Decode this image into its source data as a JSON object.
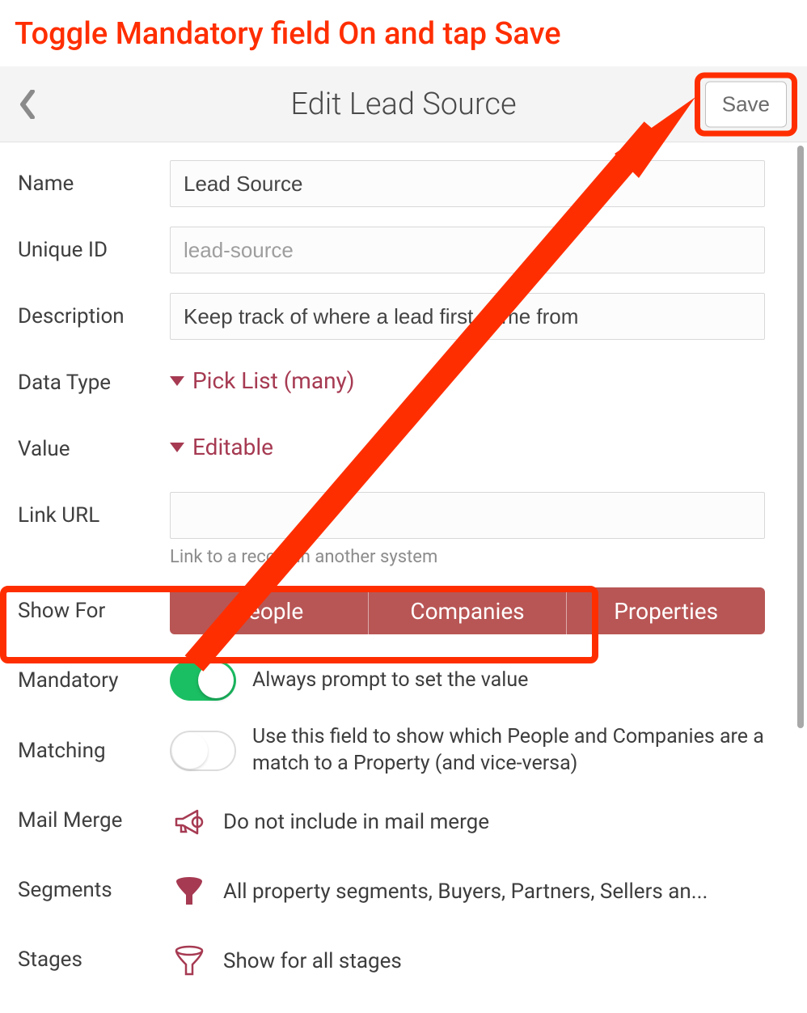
{
  "instruction": "Toggle Mandatory field On and tap Save",
  "header": {
    "title": "Edit Lead Source",
    "save_label": "Save"
  },
  "fields": {
    "name": {
      "label": "Name",
      "value": "Lead Source"
    },
    "unique_id": {
      "label": "Unique ID",
      "placeholder": "lead-source",
      "value": ""
    },
    "description": {
      "label": "Description",
      "value": "Keep track of where a lead first came from"
    },
    "data_type": {
      "label": "Data Type",
      "value": "Pick List (many)"
    },
    "value_field": {
      "label": "Value",
      "value": "Editable"
    },
    "link_url": {
      "label": "Link URL",
      "value": "",
      "hint": "Link to a record in another system"
    },
    "show_for": {
      "label": "Show For",
      "options": [
        "People",
        "Companies",
        "Properties"
      ]
    },
    "mandatory": {
      "label": "Mandatory",
      "on": true,
      "text": "Always prompt to set the value"
    },
    "matching": {
      "label": "Matching",
      "on": false,
      "text": "Use this field to show which People and Companies are a match to a Property (and vice-versa)"
    },
    "mail_merge": {
      "label": "Mail Merge",
      "text": "Do not include in mail merge"
    },
    "segments": {
      "label": "Segments",
      "text": "All property segments, Buyers, Partners, Sellers an..."
    },
    "stages": {
      "label": "Stages",
      "text": "Show for all stages"
    }
  },
  "colors": {
    "accent": "#a63a52",
    "segmented": "#b85655",
    "toggle_on": "#1bbf63",
    "highlight": "#ff2e00"
  }
}
